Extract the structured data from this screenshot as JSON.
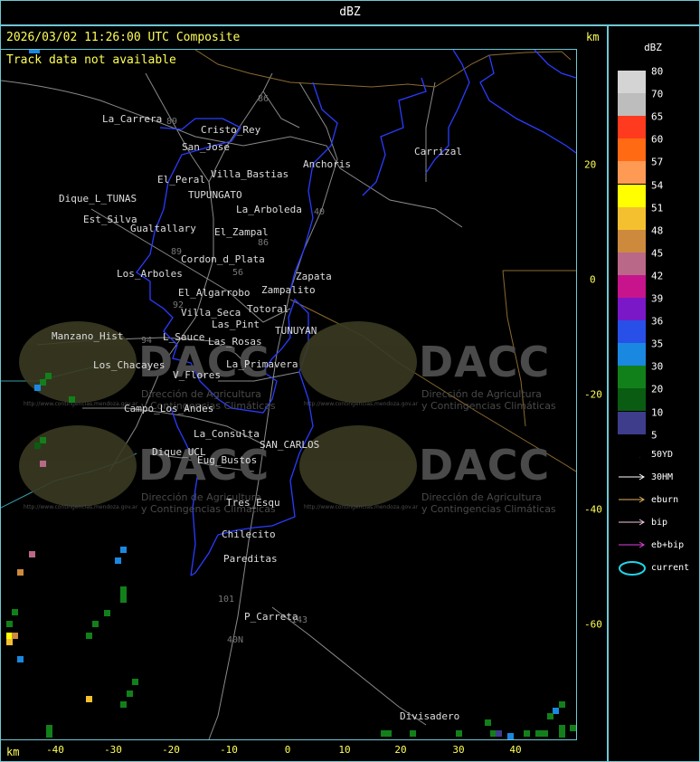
{
  "header": {
    "title": "dBZ"
  },
  "info": {
    "timestamp": "2026/03/02 11:26:00 UTC Composite",
    "track_status": "Track data not available",
    "km_unit": "km"
  },
  "axes": {
    "x_ticks": [
      "-40",
      "-30",
      "-20",
      "-10",
      "0",
      "10",
      "20",
      "30",
      "40"
    ],
    "y_ticks": [
      "20",
      "0",
      "-20",
      "-40",
      "-60"
    ]
  },
  "legend": {
    "title": "dBZ",
    "levels": [
      {
        "label": "80",
        "color": "#d4d4d4"
      },
      {
        "label": "70",
        "color": "#bdbdbd"
      },
      {
        "label": "65",
        "color": "#ff3a1f"
      },
      {
        "label": "60",
        "color": "#ff6a12"
      },
      {
        "label": "57",
        "color": "#ff9a55"
      },
      {
        "label": "54",
        "color": "#ffff00"
      },
      {
        "label": "51",
        "color": "#f5c030"
      },
      {
        "label": "48",
        "color": "#cd8a3d"
      },
      {
        "label": "45",
        "color": "#b96888"
      },
      {
        "label": "42",
        "color": "#c8148c"
      },
      {
        "label": "39",
        "color": "#7a18c8"
      },
      {
        "label": "36",
        "color": "#2850e8"
      },
      {
        "label": "35",
        "color": "#1a88e0"
      },
      {
        "label": "30",
        "color": "#12801a"
      },
      {
        "label": "20",
        "color": "#0a5c12"
      },
      {
        "label": "10",
        "color": "#3d3d8c"
      },
      {
        "label": "5",
        "color": "#000000"
      }
    ],
    "tracks": [
      {
        "label": "50YD",
        "color": "#4fd4e0"
      },
      {
        "label": "30HM",
        "color": "#ffffff"
      },
      {
        "label": "eburn",
        "color": "#e0b060"
      },
      {
        "label": "bip",
        "color": "#f0c8e0"
      },
      {
        "label": "eb+bip",
        "color": "#e040e0"
      },
      {
        "label": "current",
        "color": "#22d4e8"
      }
    ]
  },
  "towns": [
    "La_Carrera",
    "Cristo_Rey",
    "San_Jose",
    "Villa_Bastias",
    "El_Peral",
    "TUPUNGATO",
    "Dique_L_TUNAS",
    "Est_Silva",
    "Gualtallary",
    "La_Arboleda",
    "El_Zampal",
    "Anchoris",
    "Carrizal",
    "Cordon_d_Plata",
    "Los_Arboles",
    "Zapata",
    "Zampalito",
    "El_Algarrobo",
    "Villa_Seca",
    "Totoral",
    "Las_Pint",
    "TUNUYAN",
    "Manzano_Hist",
    "L_Sauce",
    "Las_Rosas",
    "La_Primavera",
    "Los_Chacayes",
    "V_Flores",
    "Campo_Los_Andes",
    "La_Consulta",
    "SAN_CARLOS",
    "Dique_UCL",
    "Eug_Bustos",
    "Tres_Esqu",
    "Chilecito",
    "Pareditas",
    "P_Carreta",
    "Divisadero"
  ],
  "route_numbers": [
    "89",
    "86",
    "40",
    "86",
    "92",
    "89",
    "94",
    "56",
    "101",
    "143",
    "40N"
  ],
  "watermark": {
    "brand": "DACC",
    "line1": "Dirección de Agricultura",
    "line2": "y Contingencias Climáticas",
    "url": "http://www.contingencias.mendoza.gov.ar"
  }
}
